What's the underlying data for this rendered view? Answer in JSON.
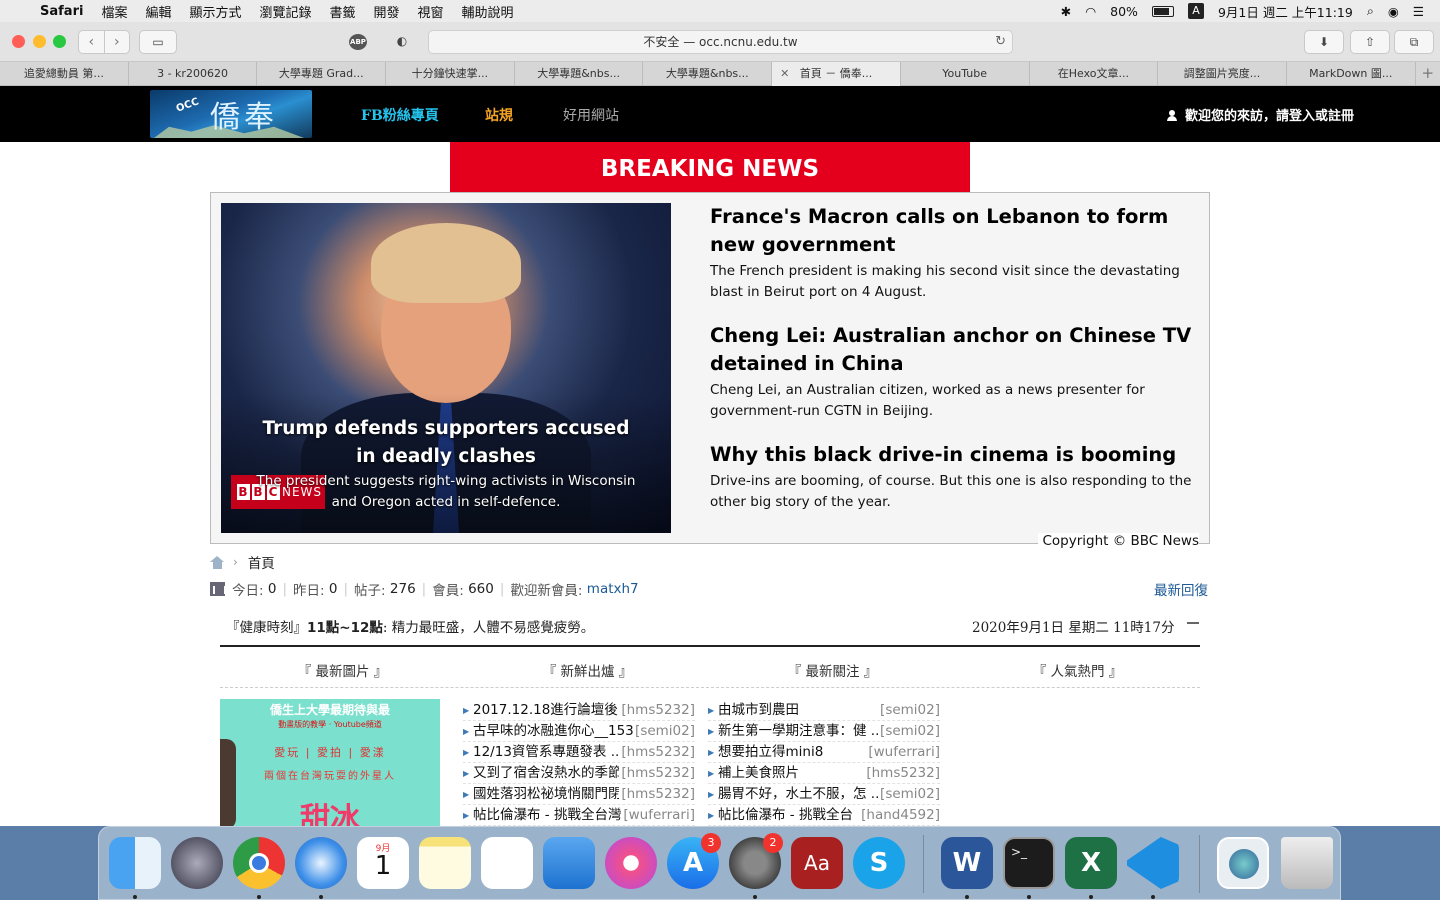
{
  "menubar": {
    "app_name": "Safari",
    "items": [
      "檔案",
      "編輯",
      "顯示方式",
      "瀏覽記錄",
      "書籤",
      "開發",
      "視窗",
      "輔助說明"
    ],
    "battery": "80%",
    "input_method": "A",
    "clock": "9月1日 週二 上午11:19"
  },
  "toolbar": {
    "abp_label": "ABP",
    "url": "不安全 — occ.ncnu.edu.tw"
  },
  "tabs": [
    {
      "label": "追愛總動員 第..."
    },
    {
      "label": "3 - kr200620"
    },
    {
      "label": "大學專題 Grad..."
    },
    {
      "label": "十分鐘快速掌..."
    },
    {
      "label": "大學專題&nbs..."
    },
    {
      "label": "大學專題&nbs..."
    },
    {
      "label": "首頁 － 僑奉..."
    },
    {
      "label": "YouTube"
    },
    {
      "label": "在Hexo文章..."
    },
    {
      "label": "調整圖片亮度..."
    },
    {
      "label": "MarkDown 圖..."
    }
  ],
  "site": {
    "logo_text": "僑奉",
    "logo_small": "OCC",
    "nav": {
      "fb": "FB粉絲專頁",
      "station": "站規",
      "sites": "好用網站"
    },
    "login": "歡迎您的來訪，請登入或註冊"
  },
  "news": {
    "banner": "BREAKING NEWS",
    "hero": {
      "title": "Trump defends supporters accused in deadly clashes",
      "desc": "The president suggests right-wing activists in Wisconsin and Oregon acted in self-defence.",
      "source_logo": "BBC NEWS"
    },
    "stories": [
      {
        "title": "France's Macron calls on Lebanon to form new government",
        "desc": "The French president is making his second visit since the devastating blast in Beirut port on 4 August."
      },
      {
        "title": "Cheng Lei: Australian anchor on Chinese TV detained in China",
        "desc": "Cheng Lei, an Australian citizen, worked as a news presenter for government-run CGTN in Beijing."
      },
      {
        "title": "Why this black drive-in cinema is booming",
        "desc": "Drive-ins are booming, of course. But this one is also responding to the other big story of the year."
      }
    ],
    "copyright": "Copyright © BBC News"
  },
  "forum": {
    "breadcrumb": "首頁",
    "stats": {
      "today_label": "今日:",
      "today": "0",
      "yesterday_label": "昨日:",
      "yesterday": "0",
      "posts_label": "帖子:",
      "posts": "276",
      "members_label": "會員:",
      "members": "660",
      "welcome_label": "歡迎新會員:",
      "new_member": "matxh7"
    },
    "latest_reply": "最新回復",
    "health_prefix": "『健康時刻』",
    "health_time": "11點~12點",
    "health_text": ": 精力最旺盛，人體不易感覺疲勞。",
    "datetime": "2020年9月1日 星期二 11時17分",
    "columns": [
      "『 最新圖片 』",
      "『 新鮮出爐 』",
      "『 最新關注 』",
      "『 人氣熱門 』"
    ],
    "promo": {
      "title": "僑生上大學最期待與最",
      "sub": "動畫版的教學 · Youtube頻道",
      "line2": "愛玩 | 愛拍 | 愛漾",
      "line3": "兩個在台灣玩耍的外星人",
      "big": "甜冰"
    },
    "new_posts": [
      {
        "title": "2017.12.18進行論壇後台",
        "user": "[hms5232]"
      },
      {
        "title": "古早味的冰融進你心__153",
        "user": "[semi02]"
      },
      {
        "title": "12/13資管系專題發表 ...",
        "user": "[hms5232]"
      },
      {
        "title": "又到了宿舍沒熱水的季節",
        "user": "[hms5232]"
      },
      {
        "title": "國姓落羽松祕境悄關門閉",
        "user": "[hms5232]"
      },
      {
        "title": "帖比倫瀑布 - 挑戰全台灣",
        "user": "[wuferrari]"
      }
    ],
    "followed_posts": [
      {
        "title": "由城市到農田",
        "user": "[semi02]"
      },
      {
        "title": "新生第一學期注意事：健 ..",
        "user": "[semi02]"
      },
      {
        "title": "想要拍立得mini8",
        "user": "[wuferrari]"
      },
      {
        "title": "補上美食照片",
        "user": "[hms5232]"
      },
      {
        "title": "腸胃不好，水土不服，怎 ..",
        "user": "[semi02]"
      },
      {
        "title": "帖比倫瀑布 - 挑戰全台",
        "user": "[hand4592]"
      }
    ]
  },
  "dock": {
    "calendar_month": "9月",
    "calendar_day": "1",
    "appstore_badge": "3",
    "prefs_badge": "2",
    "word_glyph": "W",
    "excel_glyph": "X",
    "skype_glyph": "S",
    "dictionary_glyph": "Aa"
  }
}
